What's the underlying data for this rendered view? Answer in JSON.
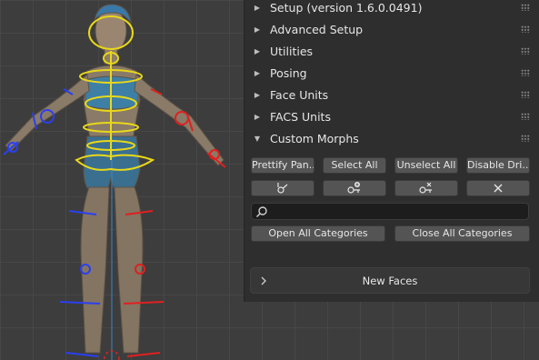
{
  "panel": {
    "sections": [
      {
        "label": "Setup (version 1.6.0.0491)",
        "expanded": false
      },
      {
        "label": "Advanced Setup",
        "expanded": false
      },
      {
        "label": "Utilities",
        "expanded": false
      },
      {
        "label": "Posing",
        "expanded": false
      },
      {
        "label": "Face Units",
        "expanded": false
      },
      {
        "label": "FACS Units",
        "expanded": false
      },
      {
        "label": "Custom Morphs",
        "expanded": true
      }
    ],
    "custom_morphs": {
      "buttons_row1": [
        "Prettify Pan...",
        "Select All",
        "Unselect All",
        "Disable Dri..."
      ],
      "icon_buttons": [
        "add-driver-icon",
        "add-key-icon",
        "remove-key-icon",
        "close-icon"
      ],
      "search": {
        "value": "",
        "placeholder": ""
      },
      "open_all_label": "Open All Categories",
      "close_all_label": "Close All Categories",
      "subpanel_title": "New Faces"
    }
  },
  "colors": {
    "panel_bg": "#2e2e2e",
    "button_bg": "#545454",
    "rig_yellow": "#e8d81a",
    "rig_blue": "#2b3ff0",
    "rig_red": "#e02020"
  }
}
